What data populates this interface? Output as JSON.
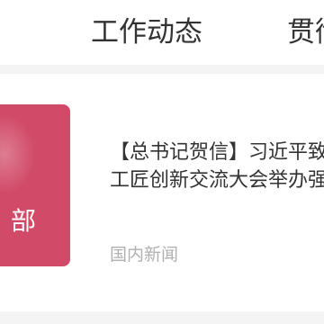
{
  "tabs": [
    {
      "label": "工作动态"
    },
    {
      "label": "贯彻"
    }
  ],
  "news": {
    "thumb_text": "部",
    "title_line1": "【总书记贺信】习近平致",
    "title_line2": "工匠创新交流大会举办强",
    "source": "国内新闻"
  },
  "colors": {
    "thumb": "#d14a68",
    "text": "#333333",
    "meta": "#b0b0b0"
  }
}
